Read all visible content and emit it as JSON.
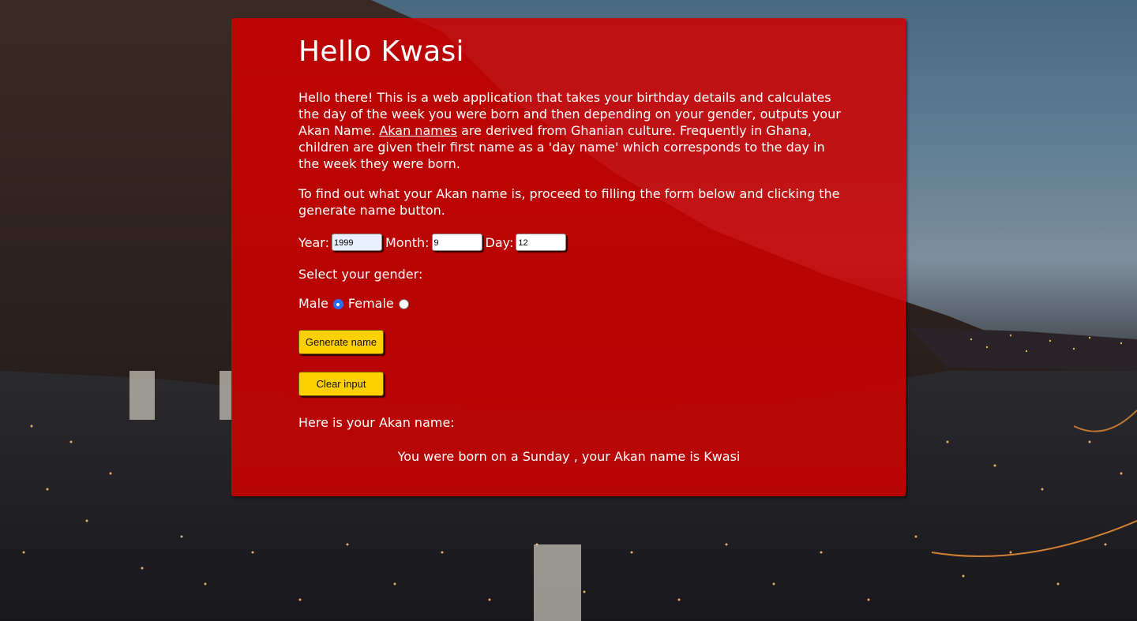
{
  "page": {
    "heading": "Hello Kwasi",
    "intro": {
      "before_link": "Hello there! This is a web application that takes your birthday details and calculates the day of the week you were born and then depending on your gender, outputs your Akan Name. ",
      "link_text": "Akan names",
      "after_link": " are derived from Ghanian culture. Frequently in Ghana, children are given their first name as a 'day name' which corresponds to the day in the week they were born."
    },
    "instructions": "To find out what your Akan name is, proceed to filling the form below and clicking the generate name button."
  },
  "form": {
    "year_label": "Year:",
    "year_value": "1999",
    "month_label": "Month:",
    "month_value": "9",
    "day_label": "Day:",
    "day_value": "12",
    "gender_prompt": "Select your gender:",
    "male_label": "Male",
    "female_label": "Female",
    "selected_gender": "Male",
    "generate_button": "Generate name",
    "clear_button": "Clear input"
  },
  "result": {
    "label": "Here is your Akan name:",
    "text": "You were born on a Sunday , your Akan name is Kwasi"
  },
  "colors": {
    "card": "#d00000",
    "button": "#ffd000",
    "radio_checked": "#2a6ef5"
  }
}
